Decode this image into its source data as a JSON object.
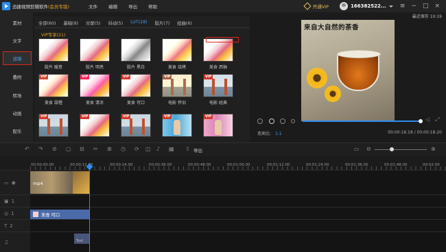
{
  "app": {
    "name": "迅捷视频剪辑软件",
    "edition": "(会员专版)"
  },
  "menu": [
    "文件",
    "编辑",
    "导出",
    "帮助"
  ],
  "header": {
    "vip": "开通VIP",
    "user": "166382522..."
  },
  "sidebar": [
    "素材",
    "文字",
    "滤镜",
    "叠附",
    "转场",
    "动画",
    "配乐"
  ],
  "tabs": [
    "全部(60)",
    "基础(9)",
    "分屏(5)",
    "抖动(5)",
    "LUT(28)",
    "胶片(7)",
    "扭曲(6)"
  ],
  "vip_title": "VIP专享(21)",
  "filters": [
    {
      "label": "胶片 暖意",
      "type": "fruit"
    },
    {
      "label": "胶片 明亮",
      "type": "fruit"
    },
    {
      "label": "胶片 黑白",
      "type": "fruit bw"
    },
    {
      "label": "美食 烧烤",
      "type": "fruit warm"
    },
    {
      "label": "美食 西柚",
      "type": "fruit"
    },
    {
      "label": "美食 甜橙",
      "type": "fruit warm"
    },
    {
      "label": "美食 清凉",
      "type": "fruit cold"
    },
    {
      "label": "美食 可口",
      "type": "fruit"
    },
    {
      "label": "电影 怀旧",
      "type": "bridge old"
    },
    {
      "label": "电影 经典",
      "type": "bridge cls"
    },
    {
      "label": "",
      "type": "bridge"
    },
    {
      "label": "",
      "type": "fruit"
    },
    {
      "label": "",
      "type": "bridge"
    },
    {
      "label": "",
      "type": "girl"
    },
    {
      "label": "",
      "type": "girl pink"
    }
  ],
  "preview": {
    "autosave": "最近保存 10:19",
    "caption": "来自大自然的茶香",
    "ratio_label": "宽高比:",
    "ratio": "1:1",
    "time": "00:00:18.18 / 00:00:18.20"
  },
  "toolbar": {
    "export": "导出"
  },
  "ruler": [
    "00:00:00.00",
    "00:00:12.00",
    "00:00:24.00",
    "00:00:36.00",
    "00:00:48.00",
    "00:01:00.00",
    "00:01:12.00",
    "00:01:24.00",
    "00:01:36.00",
    "00:01:48.00",
    "00:02:00"
  ],
  "timeline": {
    "video_clip": "mp4",
    "filter_clip": "美食 可口",
    "text_clip": "Text",
    "track_labels": [
      "1",
      "1",
      "2"
    ]
  }
}
